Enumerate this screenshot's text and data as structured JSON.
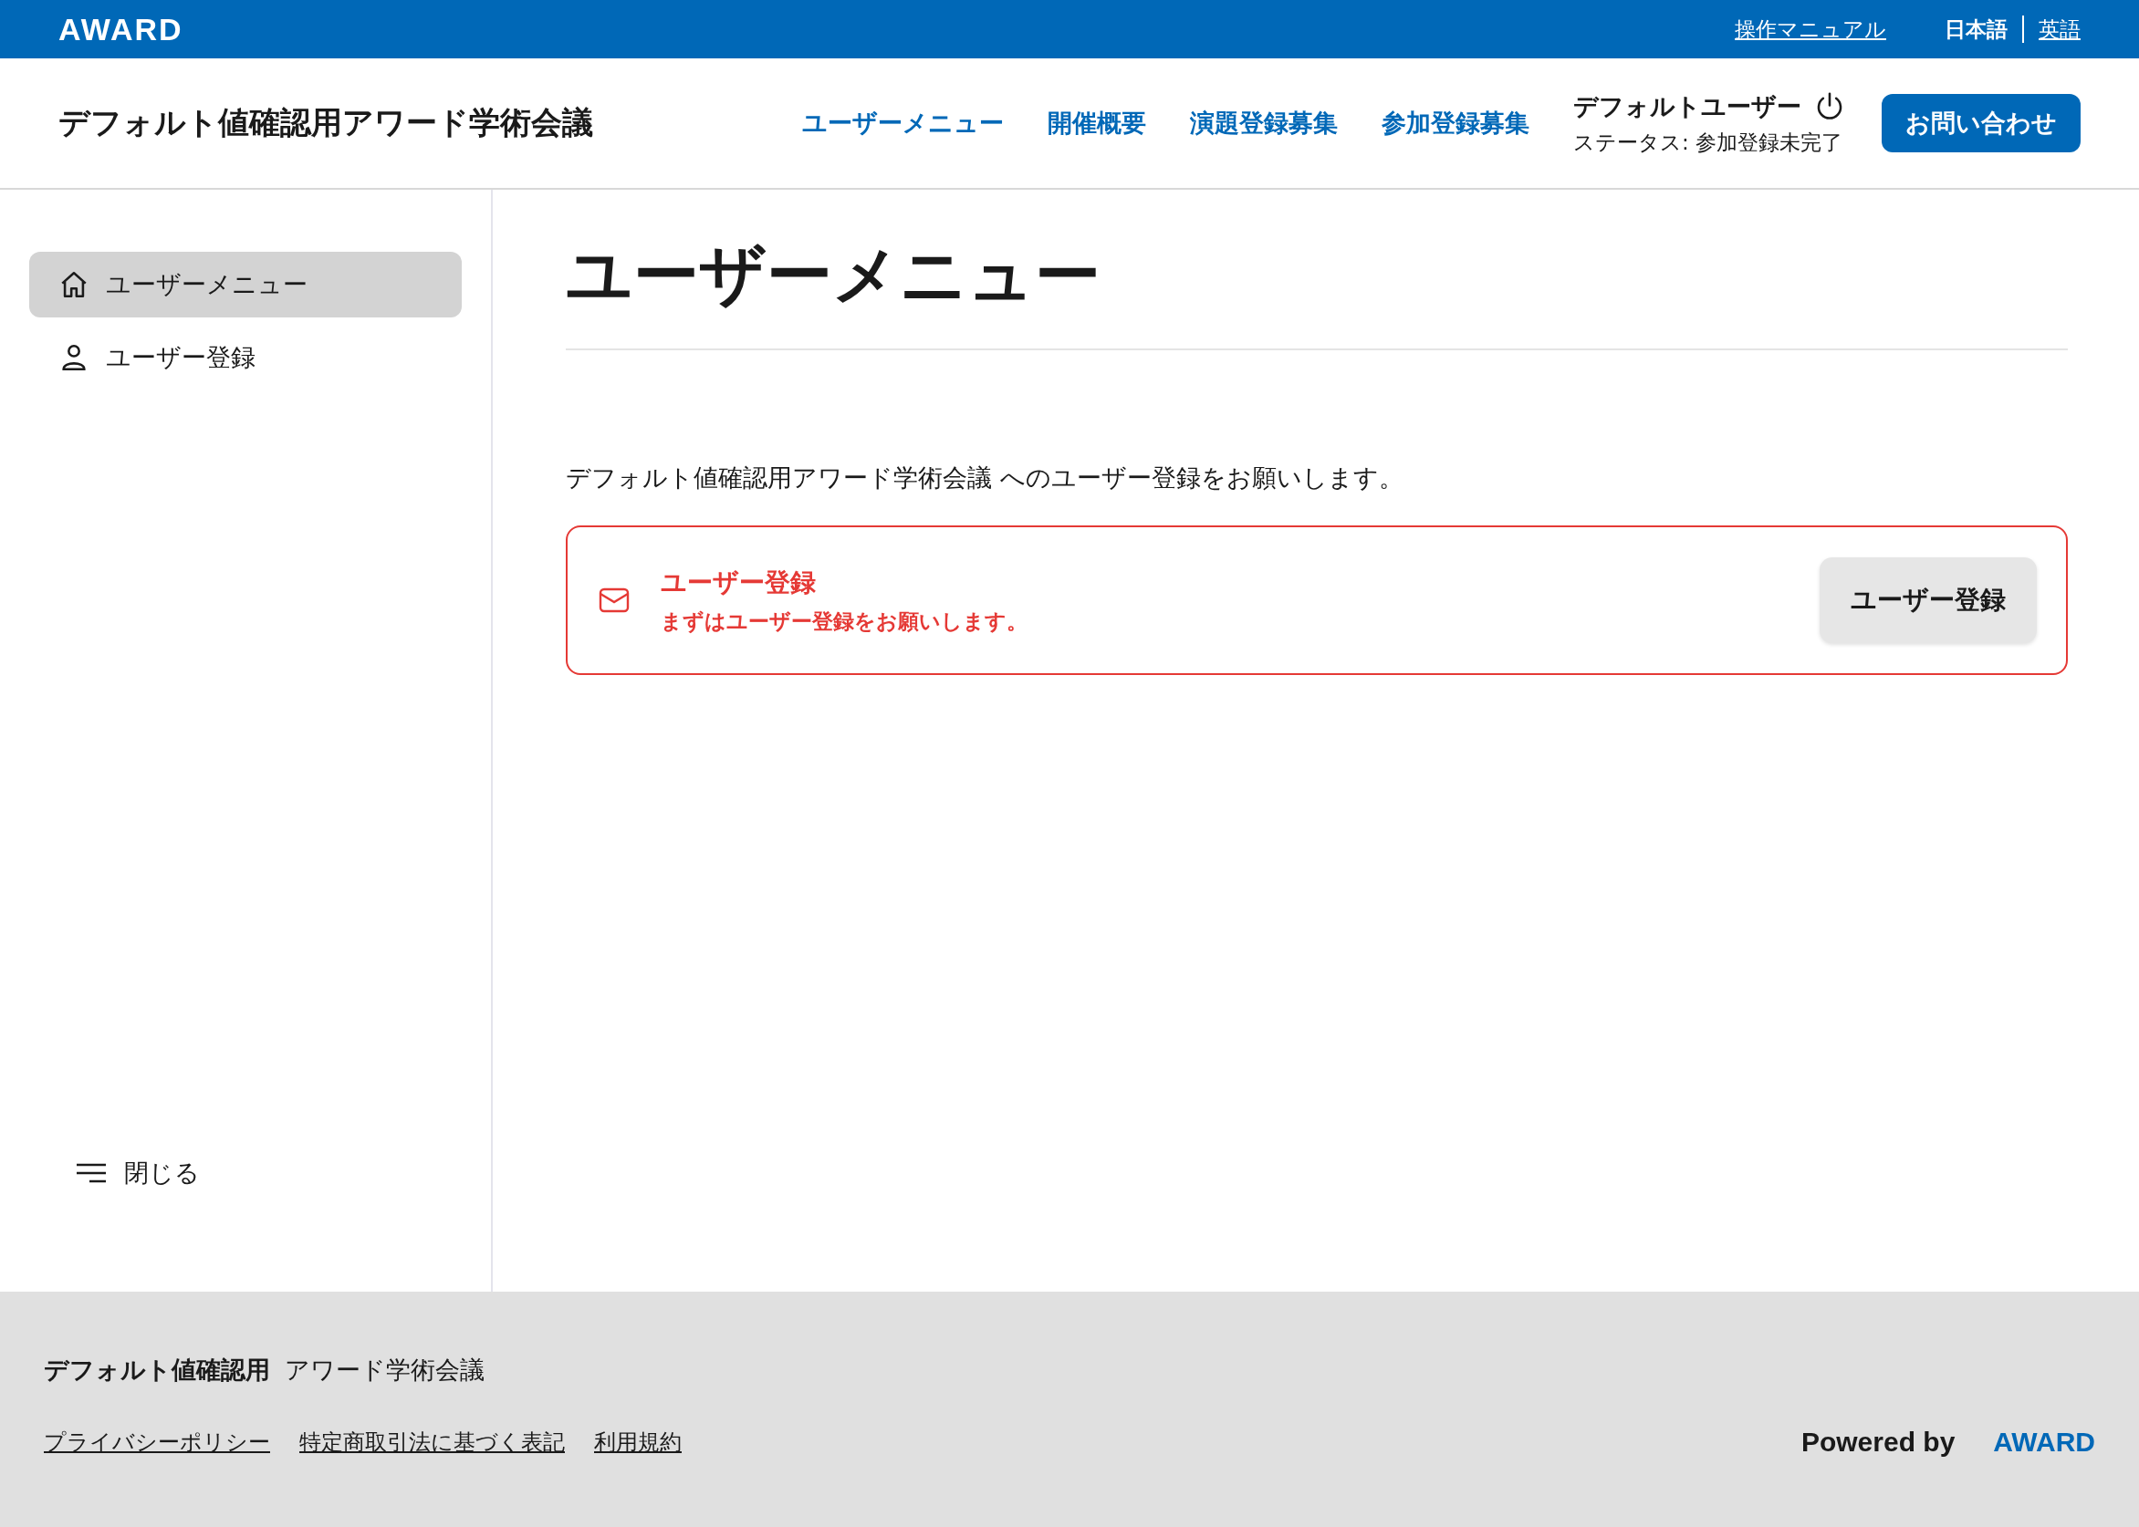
{
  "top_bar": {
    "logo": "AWARD",
    "manual_link": "操作マニュアル",
    "languages": [
      {
        "label": "日本語",
        "selected": true
      },
      {
        "label": "英語",
        "selected": false
      }
    ]
  },
  "header": {
    "title": "デフォルト値確認用アワード学術会議",
    "nav": [
      "ユーザーメニュー",
      "開催概要",
      "演題登録募集",
      "参加登録募集"
    ],
    "user": {
      "name": "デフォルトユーザー",
      "status": "ステータス: 参加登録未完了"
    },
    "contact_button": "お問い合わせ"
  },
  "sidebar": {
    "items": [
      {
        "label": "ユーザーメニュー",
        "kind": "home",
        "selected": true
      },
      {
        "label": "ユーザー登録",
        "kind": "user",
        "selected": false
      }
    ],
    "close_button": "閉じる"
  },
  "main": {
    "heading": "ユーザーメニュー",
    "intro": "デフォルト値確認用アワード学術会議 へのユーザー登録をお願いします。",
    "notice": {
      "title": "ユーザー登録",
      "message": "まずはユーザー登録をお願いします。",
      "button": "ユーザー登録"
    }
  },
  "footer": {
    "name_bold": "デフォルト値確認用",
    "name": "アワード学術会議",
    "links": [
      "プライバシーポリシー",
      "特定商取引法に基づく表記",
      "利用規約"
    ],
    "powered_by": "Powered by",
    "brand": "AWARD"
  }
}
